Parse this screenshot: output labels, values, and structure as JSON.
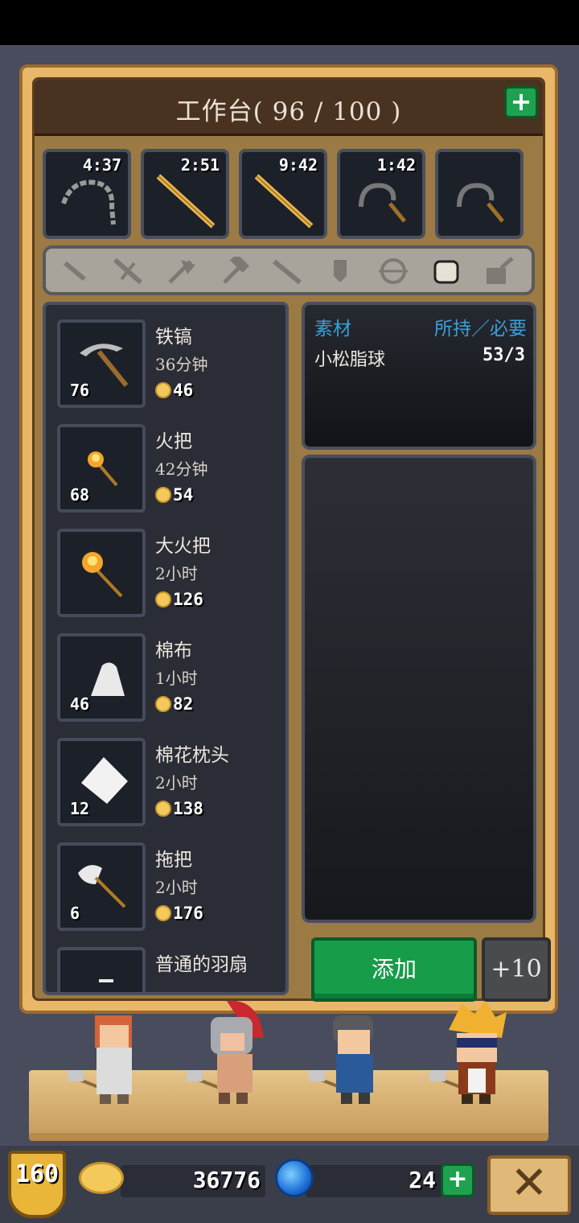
{
  "header": {
    "title": "工作台( 96 / 100 )",
    "plus_icon": "plus-icon"
  },
  "queue": [
    {
      "time": "4:37",
      "icon": "whip-icon"
    },
    {
      "time": "2:51",
      "icon": "stick-icon"
    },
    {
      "time": "9:42",
      "icon": "stick-icon"
    },
    {
      "time": "1:42",
      "icon": "sickle-icon"
    },
    {
      "time": "",
      "icon": "sickle-icon"
    }
  ],
  "categories": [
    "dagger-icon",
    "sword-icon",
    "axe-icon",
    "hammer-icon",
    "spear-icon",
    "shield-icon",
    "bow-icon",
    "armor-icon",
    "tool-icon"
  ],
  "items": [
    {
      "name": "铁镐",
      "time": "36分钟",
      "count": "76",
      "cost": "46"
    },
    {
      "name": "火把",
      "time": "42分钟",
      "count": "68",
      "cost": "54"
    },
    {
      "name": "大火把",
      "time": "2小时",
      "count": "",
      "cost": "126"
    },
    {
      "name": "棉布",
      "time": "1小时",
      "count": "46",
      "cost": "82"
    },
    {
      "name": "棉花枕头",
      "time": "2小时",
      "count": "12",
      "cost": "138"
    },
    {
      "name": "拖把",
      "time": "2小时",
      "count": "6",
      "cost": "176"
    },
    {
      "name": "普通的羽扇",
      "time": "",
      "count": "",
      "cost": ""
    }
  ],
  "materials": {
    "header_left": "素材",
    "header_right": "所持／必要",
    "rows": [
      {
        "name": "小松脂球",
        "qty": "53/3"
      }
    ]
  },
  "actions": {
    "add": "添加",
    "plus10": "+10"
  },
  "footer": {
    "level": "160",
    "coins": "36776",
    "gems": "24"
  }
}
